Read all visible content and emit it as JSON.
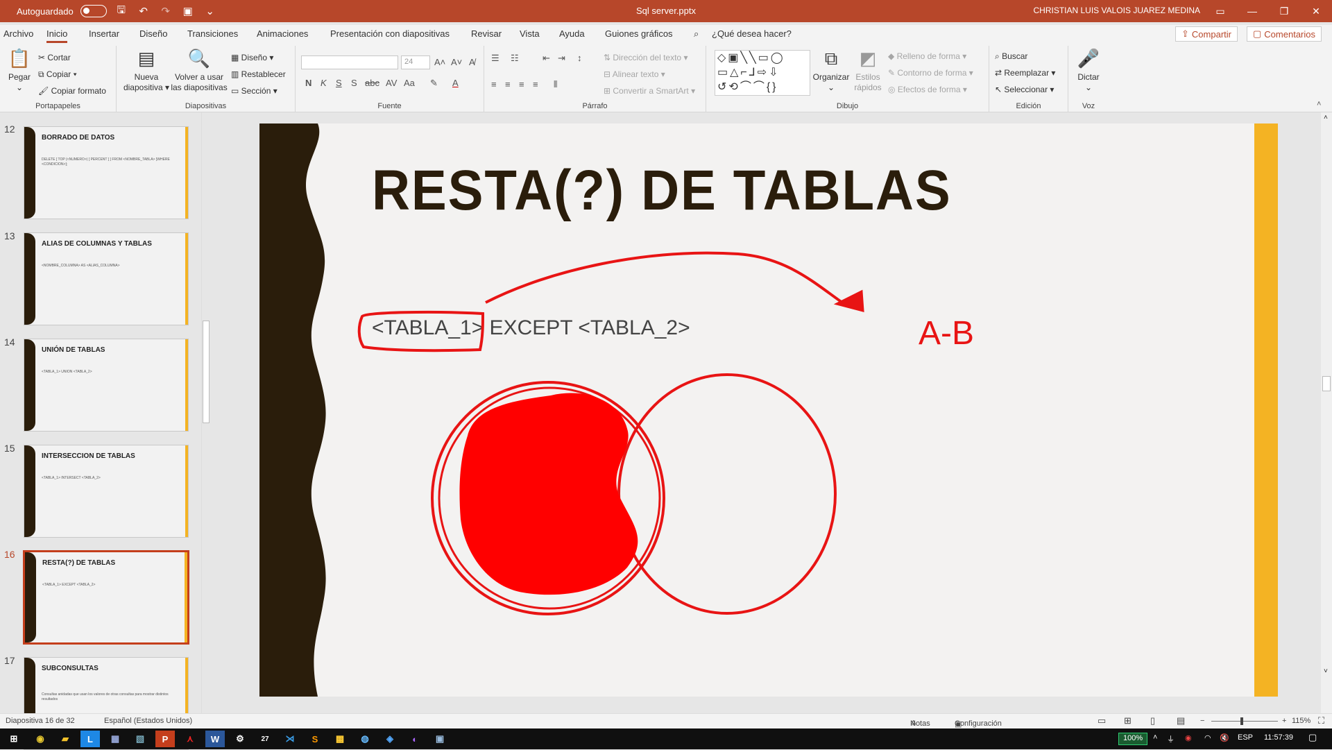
{
  "titlebar": {
    "autosave": "Autoguardado",
    "filename": "Sql server.pptx",
    "user": "CHRISTIAN LUIS VALOIS JUAREZ MEDINA",
    "controls": [
      "▭",
      "—",
      "❐",
      "✕"
    ]
  },
  "menu": {
    "tabs": [
      "Archivo",
      "Inicio",
      "Insertar",
      "Diseño",
      "Transiciones",
      "Animaciones",
      "Presentación con diapositivas",
      "Revisar",
      "Vista",
      "Ayuda",
      "Guiones gráficos"
    ],
    "search": "¿Qué desea hacer?",
    "share": "Compartir",
    "comments": "Comentarios"
  },
  "ribbon": {
    "portapapeles": {
      "label": "Portapapeles",
      "paste": "Pegar",
      "cut": "Cortar",
      "copy": "Copiar",
      "format": "Copiar formato"
    },
    "diapositivas": {
      "label": "Diapositivas",
      "new1": "Nueva",
      "new2": "diapositiva",
      "reuse1": "Volver a usar",
      "reuse2": "las diapositivas",
      "layout": "Diseño",
      "reset": "Restablecer",
      "section": "Sección"
    },
    "fuente": {
      "label": "Fuente",
      "size": "24",
      "fmt": [
        "N",
        "K",
        "S",
        "S",
        "abc",
        "AV",
        "Aa"
      ]
    },
    "parrafo": {
      "label": "Párrafo",
      "dir": "Dirección del texto",
      "align": "Alinear texto",
      "smart": "Convertir a SmartArt"
    },
    "dibujo": {
      "label": "Dibujo",
      "arrange": "Organizar",
      "styles1": "Estilos",
      "styles2": "rápidos",
      "fill": "Relleno de forma",
      "outline": "Contorno de forma",
      "effects": "Efectos de forma"
    },
    "edicion": {
      "label": "Edición",
      "find": "Buscar",
      "replace": "Reemplazar",
      "select": "Seleccionar"
    },
    "voz": {
      "label": "Voz",
      "dictate": "Dictar"
    }
  },
  "slides": [
    {
      "num": "12",
      "title": "BORRADO DE DATOS",
      "body": "DELETE [ TOP (<NUMERO>) [ PERCENT ] ] FROM <NOMBRE_TABLA> [WHERE <CONDICION>];"
    },
    {
      "num": "13",
      "title": "ALIAS DE COLUMNAS Y TABLAS",
      "body": "<NOMBRE_COLUMNA> AS <ALIAS_COLUMNA>"
    },
    {
      "num": "14",
      "title": "UNIÓN DE TABLAS",
      "body": "<TABLA_1> UNION <TABLA_2>"
    },
    {
      "num": "15",
      "title": "INTERSECCION DE TABLAS",
      "body": "<TABLA_1> INTERSECT <TABLA_2>"
    },
    {
      "num": "16",
      "title": "RESTA(?) DE TABLAS",
      "body": "<TABLA_1> EXCEPT <TABLA_2>"
    },
    {
      "num": "17",
      "title": "SUBCONSULTAS",
      "body": "Consultas anidadas que usan los valores de otras consultas para mostrar distintos resultados"
    }
  ],
  "main_slide": {
    "title": "RESTA(?) DE TABLAS",
    "body": "<TABLA_1> EXCEPT <TABLA_2>",
    "annotation": "A-B"
  },
  "statusbar": {
    "slide_info": "Diapositiva 16 de 32",
    "language": "Español (Estados Unidos)",
    "notes": "Notas",
    "display": "Configuración de visualización",
    "zoom": "115%"
  },
  "taskbar": {
    "battery": "100%",
    "lang": "ESP",
    "time": "11:57:39"
  }
}
